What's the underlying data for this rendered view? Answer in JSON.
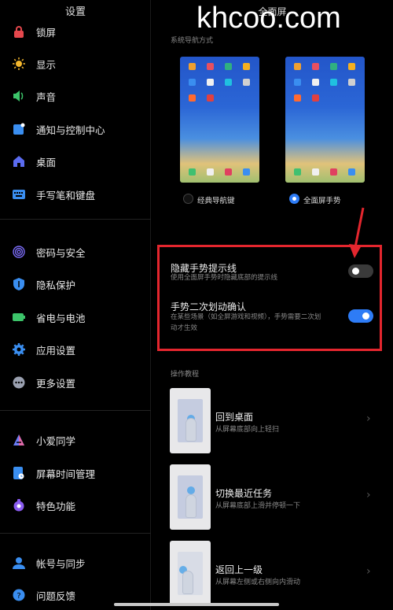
{
  "watermark": "khcoo.com",
  "sidebar": {
    "title": "设置",
    "items": [
      {
        "label": "锁屏",
        "icon": "lock-icon",
        "color": "#e5484d"
      },
      {
        "label": "显示",
        "icon": "sun-icon",
        "color": "#f5b82e"
      },
      {
        "label": "声音",
        "icon": "speaker-icon",
        "color": "#3cc46a"
      },
      {
        "label": "通知与控制中心",
        "icon": "notification-icon",
        "color": "#3a8ef0"
      },
      {
        "label": "桌面",
        "icon": "home-icon",
        "color": "#5b6cf0"
      },
      {
        "label": "手写笔和键盘",
        "icon": "keyboard-icon",
        "color": "#3a8ef0"
      },
      {
        "label": "密码与安全",
        "icon": "fingerprint-icon",
        "color": "#7b6cf6"
      },
      {
        "label": "隐私保护",
        "icon": "shield-icon",
        "color": "#3a8ef0"
      },
      {
        "label": "省电与电池",
        "icon": "battery-icon",
        "color": "#3cc46a"
      },
      {
        "label": "应用设置",
        "icon": "gear-icon",
        "color": "#3a8ef0"
      },
      {
        "label": "更多设置",
        "icon": "more-icon",
        "color": "#9aa0b0"
      },
      {
        "label": "小爱同学",
        "icon": "xiaoai-icon",
        "color": "#6a7cf5"
      },
      {
        "label": "屏幕时间管理",
        "icon": "screen-time-icon",
        "color": "#3a8ef0"
      },
      {
        "label": "特色功能",
        "icon": "feature-icon",
        "color": "#8a5cf0"
      },
      {
        "label": "帐号与同步",
        "icon": "account-icon",
        "color": "#3a8ef0"
      },
      {
        "label": "问题反馈",
        "icon": "help-icon",
        "color": "#3a8ef0"
      }
    ]
  },
  "panel": {
    "title": "全面屏",
    "nav_section_label": "系统导航方式",
    "options": [
      {
        "label": "经典导航键",
        "selected": false
      },
      {
        "label": "全面屏手势",
        "selected": true
      }
    ],
    "settings": [
      {
        "title": "隐藏手势提示线",
        "desc": "使用全面屏手势时隐藏底部的提示线",
        "enabled": false
      },
      {
        "title": "手势二次划动确认",
        "desc_line1": "在某些场景（如全屏游戏和视频），手势需要二次划",
        "desc_line2": "动才生效",
        "enabled": true
      }
    ],
    "tutorial_label": "操作教程",
    "tutorials": [
      {
        "title": "回到桌面",
        "desc": "从屏幕底部向上轻扫"
      },
      {
        "title": "切换最近任务",
        "desc": "从屏幕底部上滑并停顿一下"
      },
      {
        "title": "返回上一级",
        "desc": "从屏幕左侧或右侧向内滑动"
      }
    ]
  },
  "colors": {
    "accent": "#2e7cf6",
    "highlight": "#e4262e"
  }
}
